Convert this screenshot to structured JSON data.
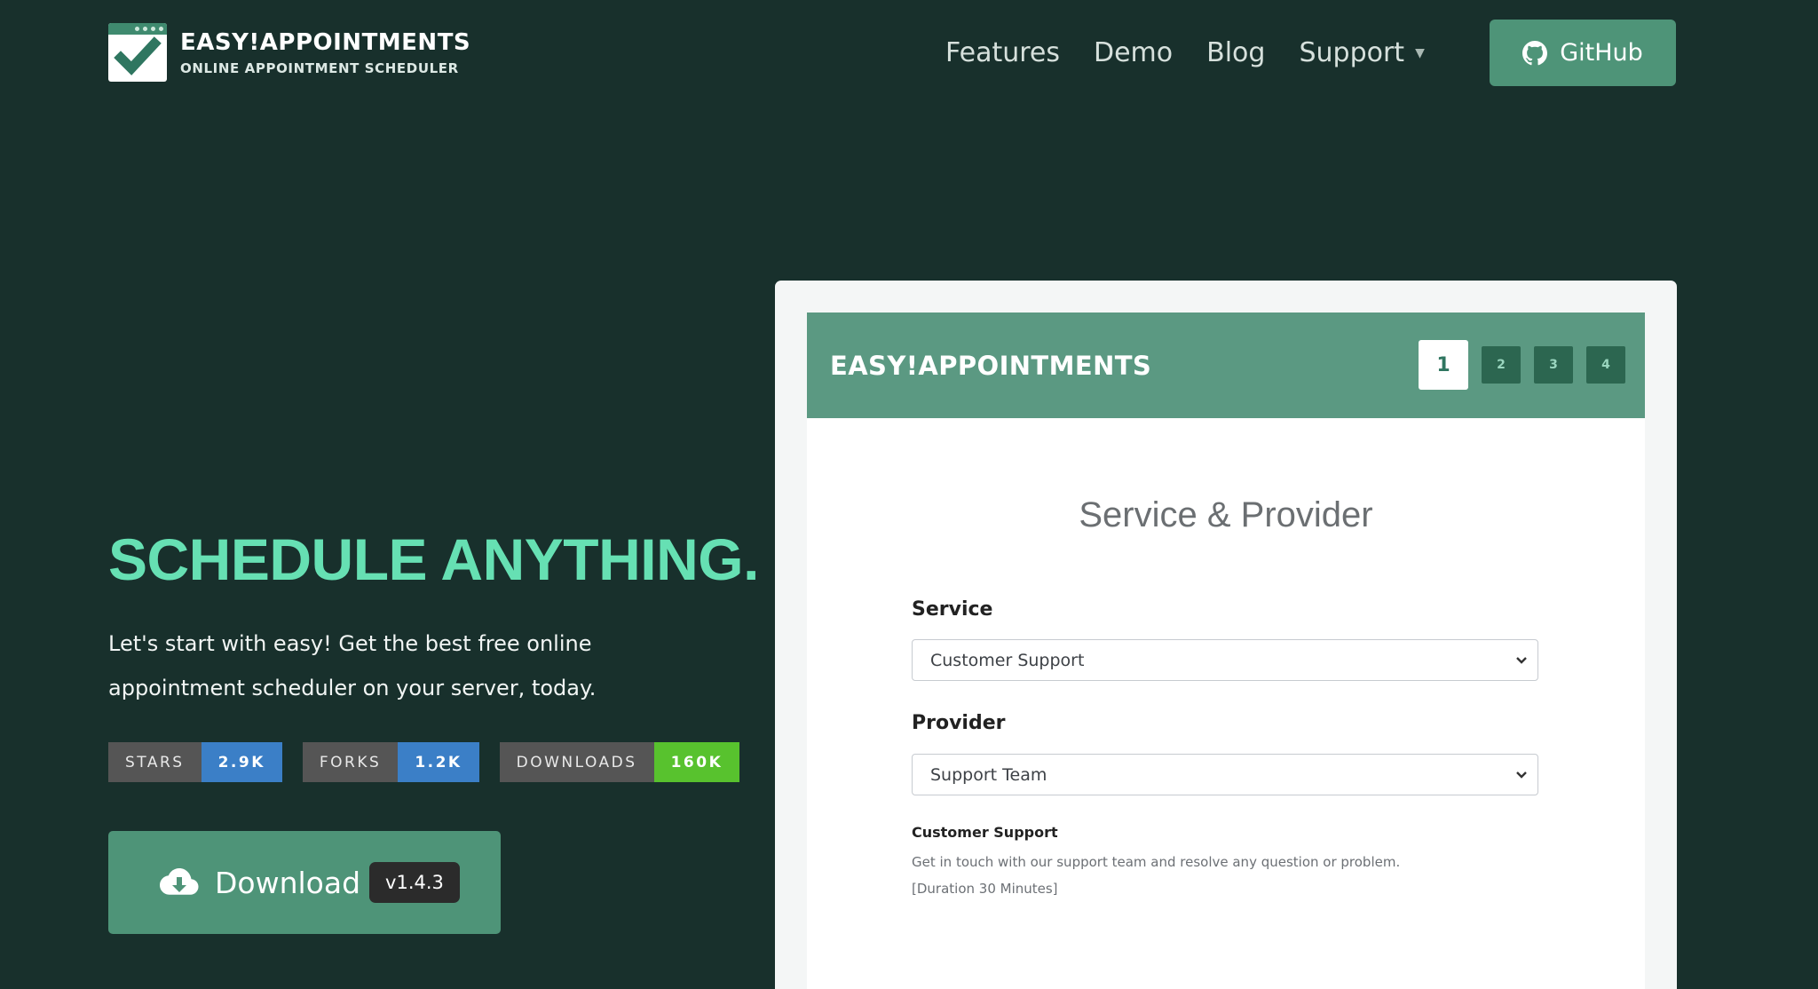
{
  "brand": {
    "title": "EASY!APPOINTMENTS",
    "subtitle": "ONLINE APPOINTMENT SCHEDULER",
    "logo_icon": "check-calendar-icon"
  },
  "nav": {
    "items": [
      "Features",
      "Demo",
      "Blog",
      "Support"
    ],
    "support_caret_icon": "caret-down-icon",
    "github_label": "GitHub",
    "github_icon": "github-icon"
  },
  "hero": {
    "headline": "SCHEDULE ANYTHING.",
    "lead": "Let's start with easy! Get the best free online appointment scheduler on your server, today.",
    "badges": [
      {
        "label": "STARS",
        "value": "2.9K",
        "color": "#3b7fc7"
      },
      {
        "label": "FORKS",
        "value": "1.2K",
        "color": "#3b7fc7"
      },
      {
        "label": "DOWNLOADS",
        "value": "160K",
        "color": "#58c22e"
      }
    ],
    "download": {
      "label": "Download",
      "version": "v1.4.3",
      "icon": "cloud-download-icon"
    }
  },
  "preview": {
    "app_title": "EASY!APPOINTMENTS",
    "steps": [
      "1",
      "2",
      "3",
      "4"
    ],
    "active_step": "1",
    "section_title": "Service & Provider",
    "service_label": "Service",
    "service_value": "Customer Support",
    "provider_label": "Provider",
    "provider_value": "Support Team",
    "service_info": {
      "name": "Customer Support",
      "description": "Get in touch with our support team and resolve any question or problem.",
      "duration": "[Duration 30 Minutes]"
    }
  },
  "colors": {
    "background": "#18302c",
    "accent": "#4e9478",
    "headline": "#66e0b3",
    "preview_header": "#5b9982"
  }
}
